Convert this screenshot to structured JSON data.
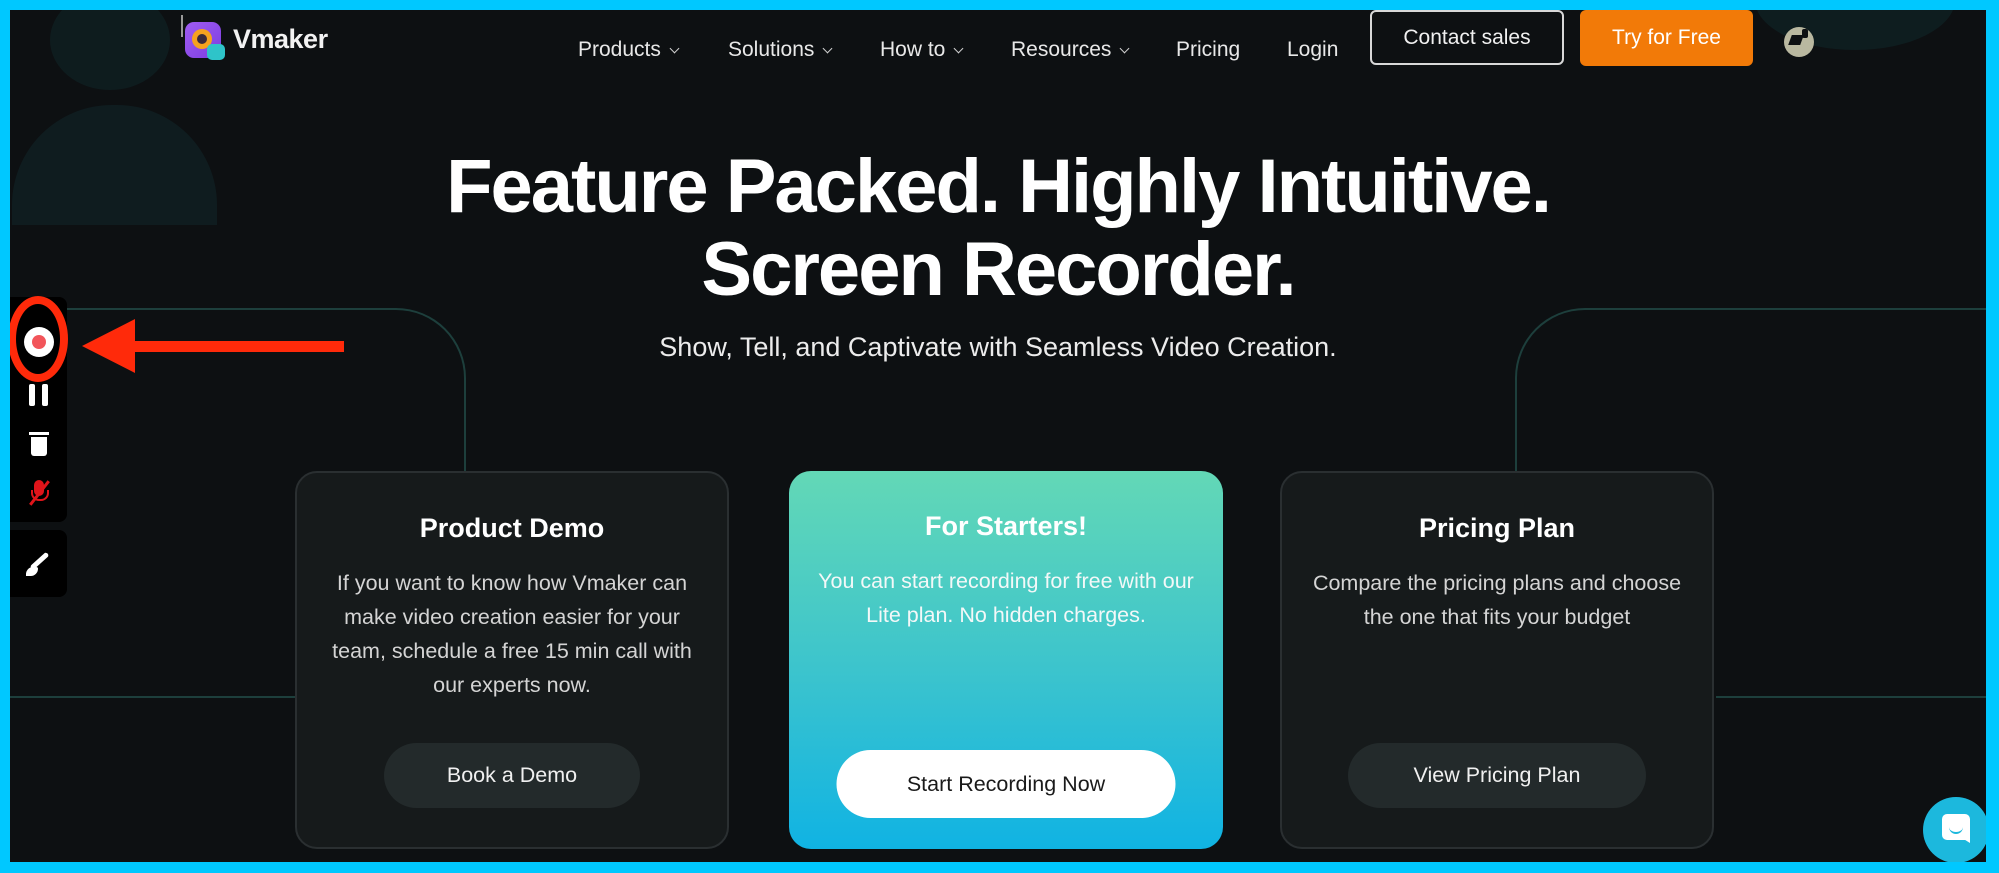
{
  "brand": {
    "name": "Vmaker",
    "logo_icon": "vmaker-camera-logo"
  },
  "nav": {
    "items": [
      {
        "label": "Products",
        "has_dropdown": true
      },
      {
        "label": "Solutions",
        "has_dropdown": true
      },
      {
        "label": "How to",
        "has_dropdown": true
      },
      {
        "label": "Resources",
        "has_dropdown": true
      },
      {
        "label": "Pricing",
        "has_dropdown": false
      },
      {
        "label": "Login",
        "has_dropdown": false
      }
    ],
    "contact_label": "Contact sales",
    "try_label": "Try for Free",
    "language_icon": "globe-icon"
  },
  "hero": {
    "title_line1": "Feature Packed. Highly Intuitive.",
    "title_line2": "Screen Recorder.",
    "subtitle": "Show, Tell, and Captivate with Seamless Video Creation."
  },
  "cards": [
    {
      "title": "Product Demo",
      "body": "If you want to know how Vmaker can make video creation easier for your team, schedule a free 15 min call with our experts now.",
      "button": "Book a Demo",
      "style": "dark"
    },
    {
      "title": "For Starters!",
      "body": "You can start recording for free with our Lite plan. No hidden charges.",
      "button": "Start Recording Now",
      "style": "accent"
    },
    {
      "title": "Pricing Plan",
      "body": "Compare the pricing plans and choose the one that fits your budget",
      "button": "View Pricing Plan",
      "style": "dark"
    }
  ],
  "recording_toolbar": {
    "tools": [
      "record-icon",
      "pause-icon",
      "trash-icon",
      "mic-muted-icon"
    ],
    "extra_tool": "brush-icon",
    "mic_state": "muted"
  },
  "annotation": {
    "type": "highlight-with-arrow",
    "target": "record-button",
    "color": "#ff2a0a"
  },
  "colors": {
    "frame": "#00c8ff",
    "background": "#0d1012",
    "cta_orange": "#f27a08",
    "accent_gradient_top": "#63d8b6",
    "accent_gradient_bottom": "#10b3e3",
    "chat_bubble": "#1cb8dd"
  },
  "chat": {
    "icon": "chat-bubble-icon"
  }
}
